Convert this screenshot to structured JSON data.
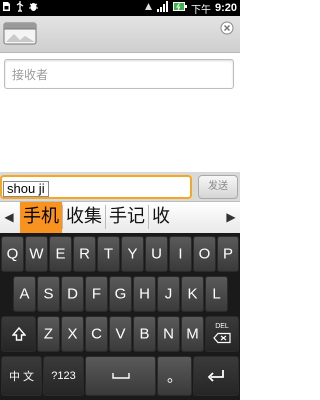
{
  "status_bar": {
    "ampm": "下午",
    "time": "9:20"
  },
  "recipient": {
    "placeholder": "接收者"
  },
  "compose": {
    "text": "shou ji",
    "send_label": "发送"
  },
  "candidates": {
    "items": [
      "手机",
      "收集",
      "手记",
      "收"
    ],
    "selected_index": 0
  },
  "keyboard": {
    "row1": [
      "Q",
      "W",
      "E",
      "R",
      "T",
      "Y",
      "U",
      "I",
      "O",
      "P"
    ],
    "row2": [
      "A",
      "S",
      "D",
      "F",
      "G",
      "H",
      "J",
      "K",
      "L"
    ],
    "row3": [
      "Z",
      "X",
      "C",
      "V",
      "B",
      "N",
      "M"
    ],
    "del_label": "DEL",
    "lang_label": "中 文",
    "sym_label": "?123",
    "dot_label": "。"
  }
}
